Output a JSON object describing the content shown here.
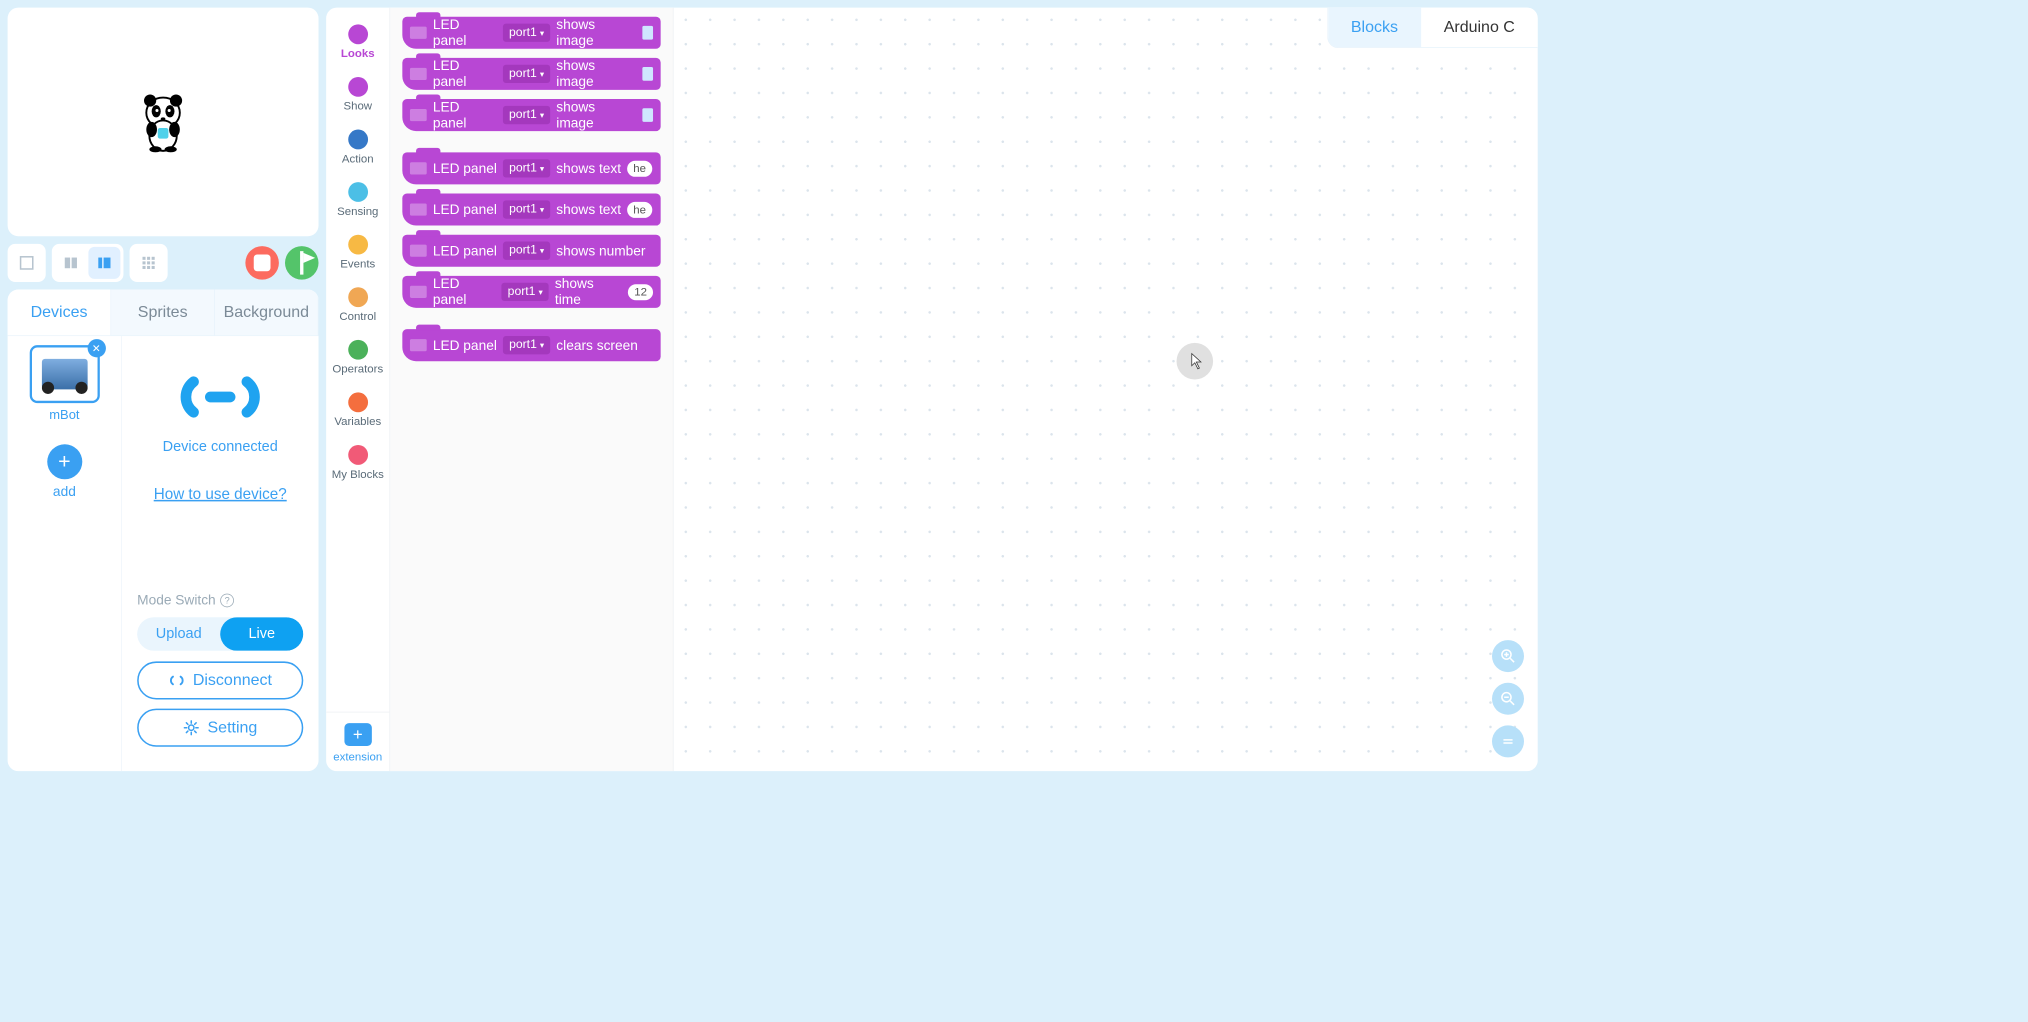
{
  "left": {
    "tabs": {
      "devices": "Devices",
      "sprites": "Sprites",
      "background": "Background"
    },
    "device": {
      "name": "mBot",
      "add": "add",
      "status": "Device connected",
      "howto": "How to use device?",
      "mode_label": "Mode Switch",
      "mode_upload": "Upload",
      "mode_live": "Live",
      "disconnect": "Disconnect",
      "setting": "Setting"
    }
  },
  "categories": [
    {
      "label": "Looks",
      "color": "#b847d4",
      "active": true
    },
    {
      "label": "Show",
      "color": "#b847d4",
      "active": false
    },
    {
      "label": "Action",
      "color": "#3578c7",
      "active": false
    },
    {
      "label": "Sensing",
      "color": "#4cbfe6",
      "active": false
    },
    {
      "label": "Events",
      "color": "#f7b944",
      "active": false
    },
    {
      "label": "Control",
      "color": "#f0a754",
      "active": false
    },
    {
      "label": "Operators",
      "color": "#4bb15a",
      "active": false
    },
    {
      "label": "Variables",
      "color": "#f46e3e",
      "active": false
    },
    {
      "label": "My Blocks",
      "color": "#f15a77",
      "active": false
    }
  ],
  "extension": "extension",
  "blocks": [
    {
      "prefix": "LED panel",
      "port": "port1",
      "action": "shows image",
      "suffix_type": "img"
    },
    {
      "prefix": "LED panel",
      "port": "port1",
      "action": "shows image",
      "suffix_type": "img"
    },
    {
      "prefix": "LED panel",
      "port": "port1",
      "action": "shows image",
      "suffix_type": "img"
    },
    {
      "prefix": "LED panel",
      "port": "port1",
      "action": "shows text",
      "suffix_type": "pill",
      "suffix": "he",
      "gap": true
    },
    {
      "prefix": "LED panel",
      "port": "port1",
      "action": "shows text",
      "suffix_type": "pill",
      "suffix": "he"
    },
    {
      "prefix": "LED panel",
      "port": "port1",
      "action": "shows number",
      "suffix_type": "none"
    },
    {
      "prefix": "LED panel",
      "port": "port1",
      "action": "shows time",
      "suffix_type": "pill",
      "suffix": "12"
    },
    {
      "prefix": "LED panel",
      "port": "port1",
      "action": "clears screen",
      "suffix_type": "none",
      "gap": true
    }
  ],
  "code_tabs": {
    "blocks": "Blocks",
    "arduino": "Arduino C"
  }
}
